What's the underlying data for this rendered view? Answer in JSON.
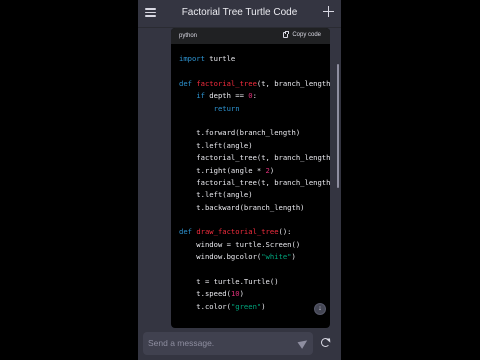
{
  "header": {
    "title": "Factorial Tree Turtle Code",
    "menu_icon": "hamburger-menu-icon",
    "new_chat_icon": "plus-icon"
  },
  "code_block": {
    "language": "python",
    "copy_label": "Copy code",
    "lines": [
      [
        {
          "t": "import",
          "c": "kw"
        },
        {
          "t": " turtle",
          "c": ""
        }
      ],
      [],
      [
        {
          "t": "def",
          "c": "kw"
        },
        {
          "t": " ",
          "c": ""
        },
        {
          "t": "factorial_tree",
          "c": "fn"
        },
        {
          "t": "(t, branch_length",
          "c": ""
        }
      ],
      [
        {
          "t": "    ",
          "c": ""
        },
        {
          "t": "if",
          "c": "kw"
        },
        {
          "t": " depth == ",
          "c": ""
        },
        {
          "t": "0",
          "c": "num"
        },
        {
          "t": ":",
          "c": ""
        }
      ],
      [
        {
          "t": "        ",
          "c": ""
        },
        {
          "t": "return",
          "c": "kw"
        }
      ],
      [],
      [
        {
          "t": "    t.forward(branch_length)",
          "c": ""
        }
      ],
      [
        {
          "t": "    t.left(angle)",
          "c": ""
        }
      ],
      [
        {
          "t": "    factorial_tree(t, branch_length",
          "c": ""
        }
      ],
      [
        {
          "t": "    t.right(angle * ",
          "c": ""
        },
        {
          "t": "2",
          "c": "num"
        },
        {
          "t": ")",
          "c": ""
        }
      ],
      [
        {
          "t": "    factorial_tree(t, branch_length",
          "c": ""
        }
      ],
      [
        {
          "t": "    t.left(angle)",
          "c": ""
        }
      ],
      [
        {
          "t": "    t.backward(branch_length)",
          "c": ""
        }
      ],
      [],
      [
        {
          "t": "def",
          "c": "kw"
        },
        {
          "t": " ",
          "c": ""
        },
        {
          "t": "draw_factorial_tree",
          "c": "fn"
        },
        {
          "t": "():",
          "c": ""
        }
      ],
      [
        {
          "t": "    window = turtle.Screen()",
          "c": ""
        }
      ],
      [
        {
          "t": "    window.bgcolor(",
          "c": ""
        },
        {
          "t": "\"white\"",
          "c": "str"
        },
        {
          "t": ")",
          "c": ""
        }
      ],
      [],
      [
        {
          "t": "    t = turtle.Turtle()",
          "c": ""
        }
      ],
      [
        {
          "t": "    t.speed(",
          "c": ""
        },
        {
          "t": "10",
          "c": "num"
        },
        {
          "t": ")",
          "c": ""
        }
      ],
      [
        {
          "t": "    t.color(",
          "c": ""
        },
        {
          "t": "\"green\"",
          "c": "str"
        },
        {
          "t": ")",
          "c": ""
        }
      ]
    ]
  },
  "composer": {
    "placeholder": "Send a message.",
    "send_icon": "send-icon",
    "regenerate_icon": "regenerate-icon"
  },
  "scroll_down_icon": "arrow-down-icon",
  "colors": {
    "background": "#343541",
    "code_bg": "#000000",
    "keyword": "#2e95d3",
    "function": "#f22c3d",
    "number": "#df3079",
    "string": "#00a67d"
  }
}
